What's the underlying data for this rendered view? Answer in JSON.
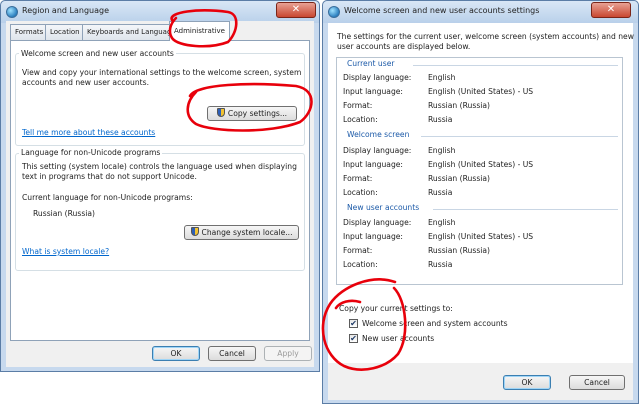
{
  "left_window": {
    "title": "Region and Language",
    "close_glyph": "✕",
    "tabs": [
      "Formats",
      "Location",
      "Keyboards and Languages",
      "Administrative"
    ],
    "welcome_group": {
      "title": "Welcome screen and new user accounts",
      "desc_line1": "View and copy your international settings to the welcome screen, system",
      "desc_line2": "accounts and new user accounts.",
      "copy_button": "Copy settings...",
      "link": "Tell me more about these accounts"
    },
    "unicode_group": {
      "title": "Language for non-Unicode programs",
      "desc_line1": "This setting (system locale) controls the language used when displaying",
      "desc_line2": "text in programs that do not support Unicode.",
      "current_label": "Current language for non-Unicode programs:",
      "current_value": "Russian (Russia)",
      "change_button": "Change system locale...",
      "link": "What is system locale?"
    },
    "buttons": {
      "ok": "OK",
      "cancel": "Cancel",
      "apply": "Apply"
    }
  },
  "right_window": {
    "title": "Welcome screen and new user accounts settings",
    "close_glyph": "✕",
    "intro_line1": "The settings for the current user, welcome screen (system accounts) and new",
    "intro_line2": "user accounts are displayed below.",
    "labels": {
      "display": "Display language:",
      "input": "Input language:",
      "format": "Format:",
      "location": "Location:"
    },
    "sections": [
      {
        "title": "Current user",
        "display": "English",
        "input": "English (United States) - US",
        "format": "Russian (Russia)",
        "location": "Russia"
      },
      {
        "title": "Welcome screen",
        "display": "English",
        "input": "English (United States) - US",
        "format": "Russian (Russia)",
        "location": "Russia"
      },
      {
        "title": "New user accounts",
        "display": "English",
        "input": "English (United States) - US",
        "format": "Russian (Russia)",
        "location": "Russia"
      }
    ],
    "copy_heading": "Copy your current settings to:",
    "checkboxes": [
      {
        "label": "Welcome screen and system accounts",
        "checked": true,
        "glyph": "✔"
      },
      {
        "label": "New user accounts",
        "checked": true,
        "glyph": "✔"
      }
    ],
    "buttons": {
      "ok": "OK",
      "cancel": "Cancel"
    }
  },
  "annotation_color": "#e8000b"
}
